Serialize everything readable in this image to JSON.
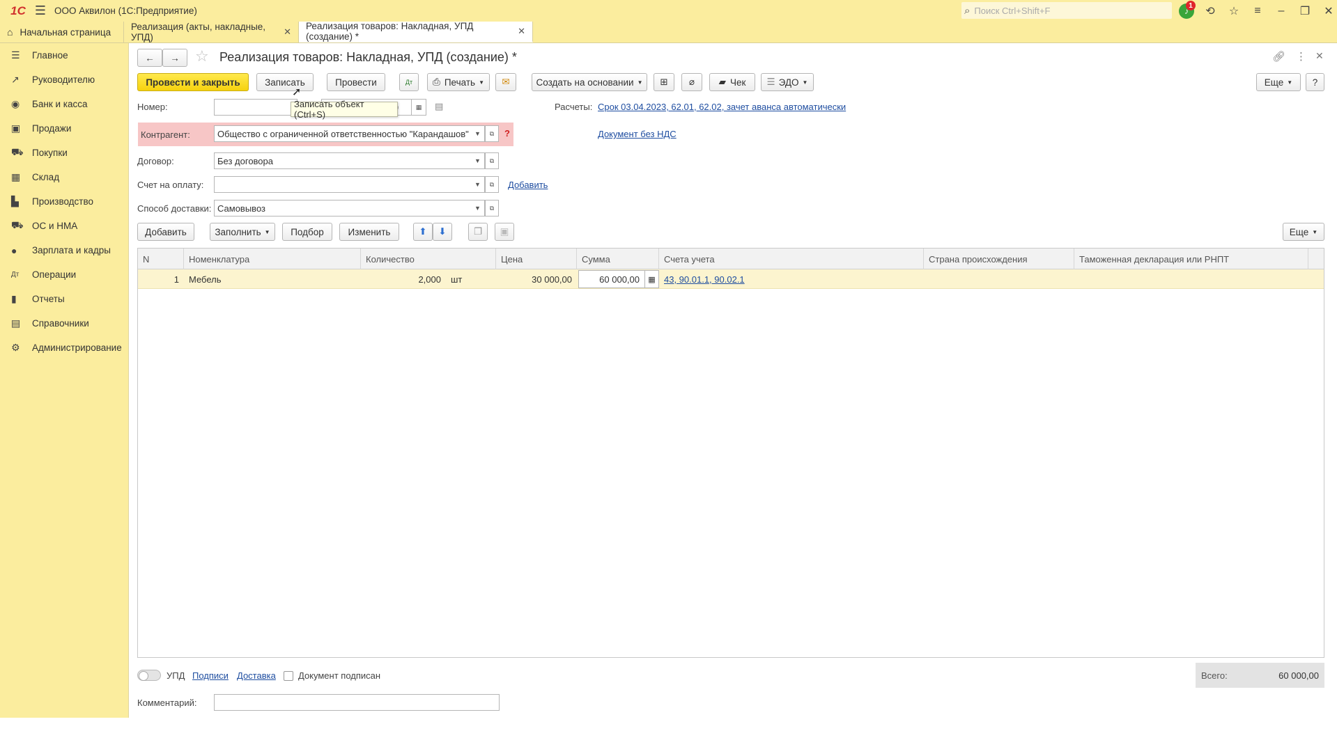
{
  "titlebar": {
    "logo": "1С",
    "app_title": "ООО Аквилон  (1С:Предприятие)",
    "search_placeholder": "Поиск Ctrl+Shift+F",
    "notifications_count": "1"
  },
  "tabs": [
    {
      "label": "Начальная страница"
    },
    {
      "label": "Реализация (акты, накладные, УПД)"
    },
    {
      "label": "Реализация товаров: Накладная, УПД (создание) *"
    }
  ],
  "sidebar": {
    "items": [
      {
        "label": "Главное",
        "icon": "menu-lines-icon"
      },
      {
        "label": "Руководителю",
        "icon": "trend-icon"
      },
      {
        "label": "Банк и касса",
        "icon": "coin-icon"
      },
      {
        "label": "Продажи",
        "icon": "bag-icon"
      },
      {
        "label": "Покупки",
        "icon": "cart-icon"
      },
      {
        "label": "Склад",
        "icon": "warehouse-icon"
      },
      {
        "label": "Производство",
        "icon": "factory-icon"
      },
      {
        "label": "ОС и НМА",
        "icon": "truck-icon"
      },
      {
        "label": "Зарплата и кадры",
        "icon": "person-icon"
      },
      {
        "label": "Операции",
        "icon": "dt-kt-icon"
      },
      {
        "label": "Отчеты",
        "icon": "bar-chart-icon"
      },
      {
        "label": "Справочники",
        "icon": "book-icon"
      },
      {
        "label": "Администрирование",
        "icon": "gear-icon"
      }
    ]
  },
  "doc": {
    "title": "Реализация товаров: Накладная, УПД (создание) *",
    "toolbar": {
      "post_close": "Провести и закрыть",
      "save": "Записать",
      "post": "Провести",
      "print": "Печать",
      "create_based": "Создать на основании",
      "check": "Чек",
      "edo": "ЭДО",
      "more": "Еще",
      "help": "?"
    },
    "tooltip": "Записать объект (Ctrl+S)",
    "fields": {
      "number_label": "Номер:",
      "number_value": "",
      "date_partial": "0",
      "counterparty_label": "Контрагент:",
      "counterparty_value": "Общество с ограниченной ответственностью \"Карандашов\"",
      "contract_label": "Договор:",
      "contract_value": "Без договора",
      "invoice_label": "Счет на оплату:",
      "invoice_value": "",
      "add_link": "Добавить",
      "delivery_label": "Способ доставки:",
      "delivery_value": "Самовывоз",
      "settlements_label": "Расчеты:",
      "settlements_link": "Срок 03.04.2023, 62.01, 62.02, зачет аванса автоматически",
      "vat_link": "Документ без НДС"
    },
    "table_toolbar": {
      "add": "Добавить",
      "fill": "Заполнить",
      "pick": "Подбор",
      "change": "Изменить",
      "more": "Еще"
    },
    "table": {
      "columns": [
        "N",
        "Номенклатура",
        "Количество",
        "Цена",
        "Сумма",
        "Счета учета",
        "Страна происхождения",
        "Таможенная декларация или РНПТ"
      ],
      "rows": [
        {
          "n": "1",
          "item": "Мебель",
          "qty": "2,000",
          "unit": "шт",
          "price": "30 000,00",
          "sum": "60 000,00",
          "accounts": "43, 90.01.1, 90.02.1",
          "country": "",
          "customs": ""
        }
      ]
    },
    "footer": {
      "upd_label": "УПД",
      "signatures_link": "Подписи",
      "delivery_link": "Доставка",
      "signed_label": "Документ подписан",
      "comment_label": "Комментарий:",
      "comment_value": "",
      "total_label": "Всего:",
      "total_value": "60 000,00"
    }
  }
}
